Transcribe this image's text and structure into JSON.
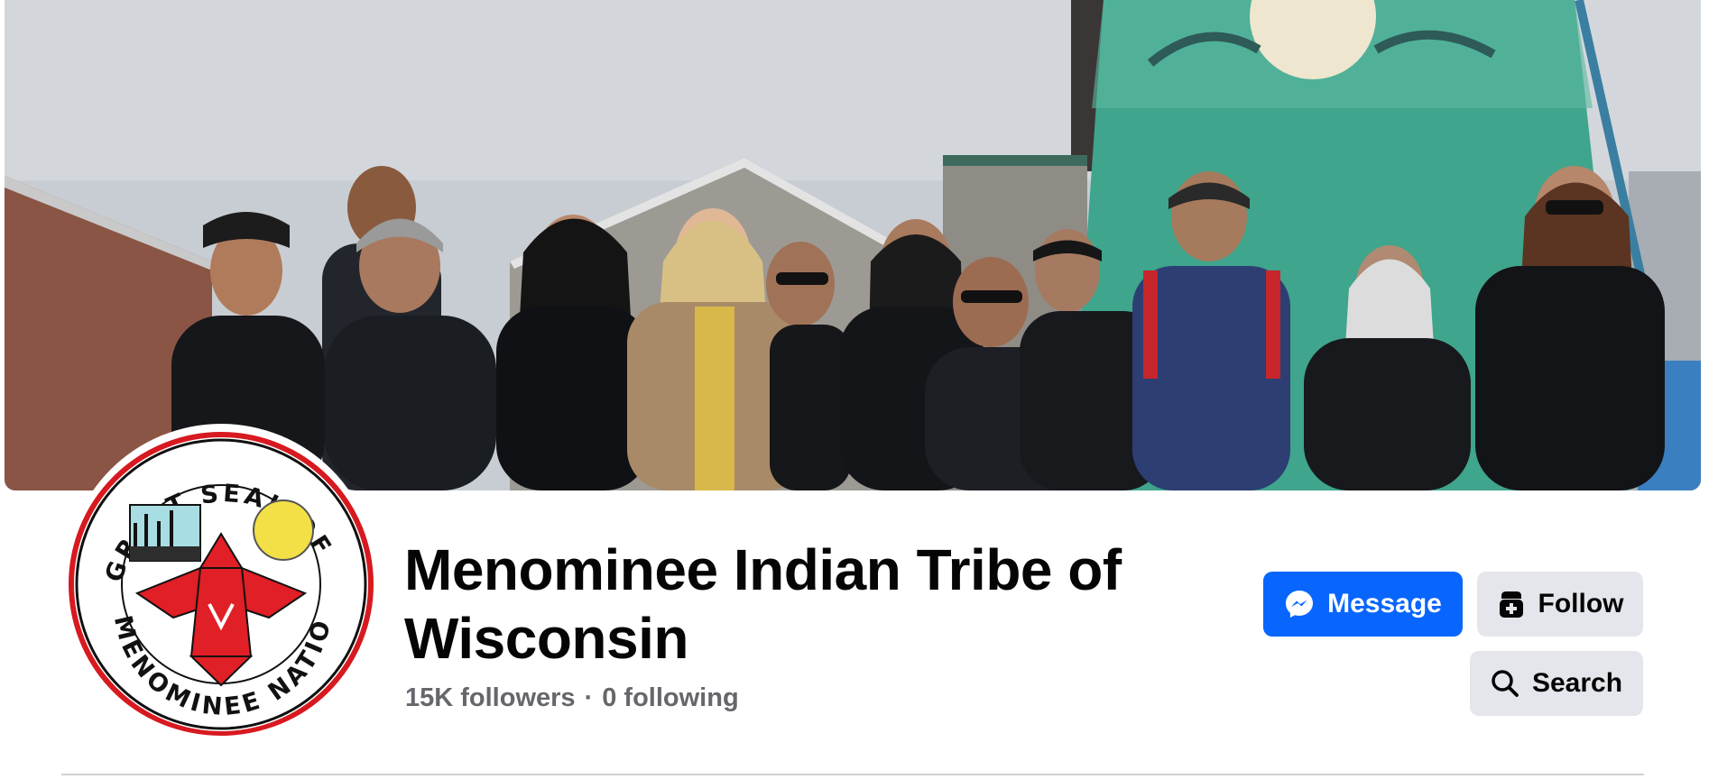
{
  "profile": {
    "name": "Menominee Indian Tribe of Wisconsin",
    "followers": "15K followers",
    "separator": "·",
    "following": "0 following"
  },
  "avatar": {
    "seal_text_top": "GREAT SEAL OF THE",
    "seal_text_bottom": "MENOMINEE NATION"
  },
  "actions": {
    "message_label": "Message",
    "follow_label": "Follow",
    "search_label": "Search"
  },
  "icons": {
    "message": "messenger-icon",
    "follow": "follow-icon",
    "search": "search-icon"
  },
  "colors": {
    "primary_button": "#0866ff",
    "secondary_button": "#e4e6eb",
    "name_text": "#050505",
    "secondary_text": "#65676b",
    "divider": "#ced0d4"
  }
}
